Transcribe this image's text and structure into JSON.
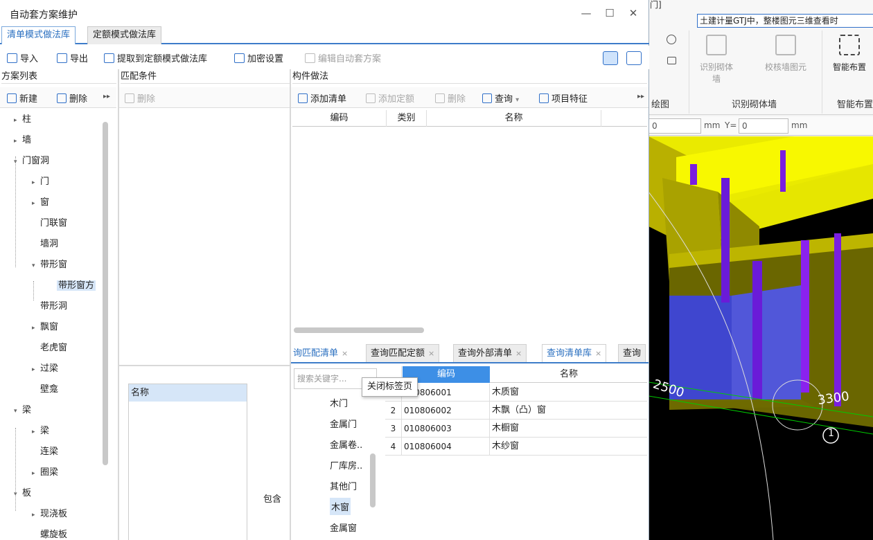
{
  "dialog": {
    "title": "自动套方案维护",
    "window_buttons": {
      "minimize": "—",
      "maximize": "☐",
      "close": "✕"
    }
  },
  "library_tabs": [
    {
      "label": "清单模式做法库",
      "active": true
    },
    {
      "label": "定额模式做法库",
      "active": false
    }
  ],
  "toolbar": {
    "import": "导入",
    "export": "导出",
    "extract": "提取到定额模式做法库",
    "encrypt": "加密设置",
    "edit_scheme": "编辑自动套方案"
  },
  "scheme_list": {
    "header": "方案列表",
    "new": "新建",
    "delete": "删除",
    "more": "▸▸",
    "tree": [
      {
        "label": "柱",
        "level": 0,
        "state": "collapsed"
      },
      {
        "label": "墙",
        "level": 0,
        "state": "collapsed"
      },
      {
        "label": "门窗洞",
        "level": 0,
        "state": "expanded"
      },
      {
        "label": "门",
        "level": 1,
        "state": "collapsed"
      },
      {
        "label": "窗",
        "level": 1,
        "state": "collapsed"
      },
      {
        "label": "门联窗",
        "level": 1,
        "state": "leaf"
      },
      {
        "label": "墙洞",
        "level": 1,
        "state": "leaf"
      },
      {
        "label": "带形窗",
        "level": 1,
        "state": "expanded"
      },
      {
        "label": "带形窗方",
        "level": 2,
        "state": "selected"
      },
      {
        "label": "带形洞",
        "level": 1,
        "state": "leaf"
      },
      {
        "label": "飘窗",
        "level": 1,
        "state": "collapsed"
      },
      {
        "label": "老虎窗",
        "level": 1,
        "state": "leaf"
      },
      {
        "label": "过梁",
        "level": 1,
        "state": "collapsed"
      },
      {
        "label": "壁龛",
        "level": 1,
        "state": "leaf"
      },
      {
        "label": "梁",
        "level": 0,
        "state": "expanded"
      },
      {
        "label": "梁",
        "level": 1,
        "state": "collapsed"
      },
      {
        "label": "连梁",
        "level": 1,
        "state": "leaf"
      },
      {
        "label": "圈梁",
        "level": 1,
        "state": "collapsed"
      },
      {
        "label": "板",
        "level": 0,
        "state": "expanded"
      },
      {
        "label": "现浇板",
        "level": 1,
        "state": "collapsed"
      },
      {
        "label": "螺旋板",
        "level": 1,
        "state": "leaf"
      }
    ]
  },
  "match_conditions": {
    "header": "匹配条件",
    "delete": "删除",
    "name_column": "名称",
    "operator": "包含"
  },
  "component_method": {
    "header": "构件做法",
    "add_list": "添加清单",
    "add_quota": "添加定额",
    "delete": "删除",
    "query": "查询",
    "item_feature": "项目特征",
    "more": "▸▸",
    "columns": {
      "code": "编码",
      "category": "类别",
      "name": "名称"
    }
  },
  "query_tabs": [
    {
      "label": "询匹配清单",
      "active": false
    },
    {
      "label": "查询匹配定额",
      "active": false
    },
    {
      "label": "查询外部清单",
      "active": false
    },
    {
      "label": "查询清单库",
      "active": true
    },
    {
      "label": "查询",
      "active": false
    }
  ],
  "query_panel": {
    "search_placeholder": "搜索关键字...",
    "tooltip": "关闭标签页",
    "categories": [
      "木门",
      "金属门",
      "金属卷..",
      "厂库房..",
      "其他门",
      "木窗",
      "金属窗"
    ],
    "selected_category": "木窗",
    "columns": {
      "code": "编码",
      "name": "名称"
    },
    "rows": [
      {
        "no": "1",
        "code": "010806001",
        "name": "木质窗"
      },
      {
        "no": "2",
        "code": "010806002",
        "name": "木飘（凸）窗"
      },
      {
        "no": "3",
        "code": "010806003",
        "name": "木橱窗"
      },
      {
        "no": "4",
        "code": "010806004",
        "name": "木纱窗"
      }
    ]
  },
  "background_app": {
    "top_text": "门]",
    "notice": "土建计量GTJ中，整楼图元三维查看时",
    "ribbon_buttons": [
      "识别砌体墙",
      "校核墙图元",
      "智能布置"
    ],
    "group_labels": [
      "绘图",
      "识别砌体墙",
      "智能布置"
    ],
    "coord": {
      "x_value": "0",
      "unit": "mm",
      "y_label": "Y=",
      "y_value": "0"
    },
    "dimensions": [
      "2500",
      "3300"
    ],
    "axis_marker": "1"
  },
  "colors": {
    "accent": "#2f6fc8",
    "selected_row": "#d6e6f8",
    "grid_header_active": "#3d8fe6"
  }
}
